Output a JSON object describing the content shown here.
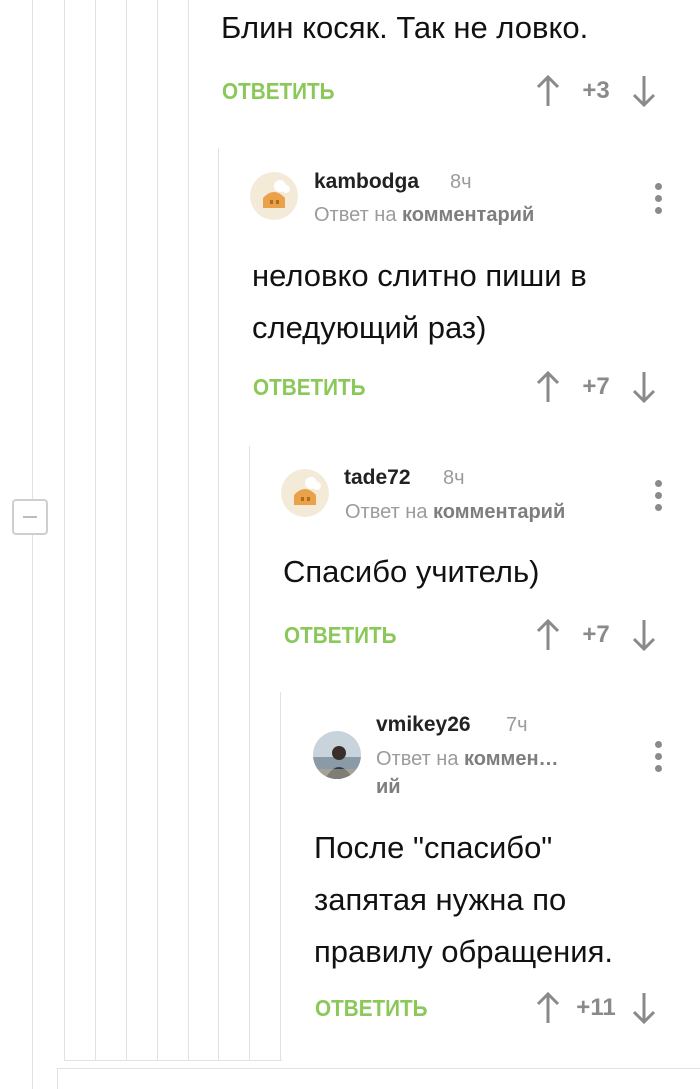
{
  "comments": [
    {
      "text": "Блин косяк. Так не ловко.",
      "reply_label": "ОТВЕТИТЬ",
      "score": "+3"
    },
    {
      "author": "kambodga",
      "time": "8ч",
      "reply_to_prefix": "Ответ на",
      "reply_to_link": "комментарий",
      "text_line1": "неловко слитно пиши в",
      "text_line2": "следующий раз)",
      "reply_label": "ОТВЕТИТЬ",
      "score": "+7"
    },
    {
      "author": "tade72",
      "time": "8ч",
      "reply_to_prefix": "Ответ на",
      "reply_to_link": "комментарий",
      "text_line1": "Спасибо учитель)",
      "reply_label": "ОТВЕТИТЬ",
      "score": "+7"
    },
    {
      "author": "vmikey26",
      "time": "7ч",
      "reply_to_prefix": "Ответ на",
      "reply_to_link": "коммен…",
      "reply_to_link_wrap": "ий",
      "text_line1": "После \"спасибо\"",
      "text_line2": "запятая нужна по",
      "text_line3": "правилу обращения.",
      "reply_label": "ОТВЕТИТЬ",
      "score": "+11"
    }
  ],
  "colors": {
    "accent": "#8ac858",
    "muted": "#9b9b9b",
    "thread_line": "#e2e2e2"
  },
  "icons": [
    "upvote-arrow-icon",
    "downvote-arrow-icon",
    "more-dots-icon",
    "collapse-minus-icon"
  ]
}
